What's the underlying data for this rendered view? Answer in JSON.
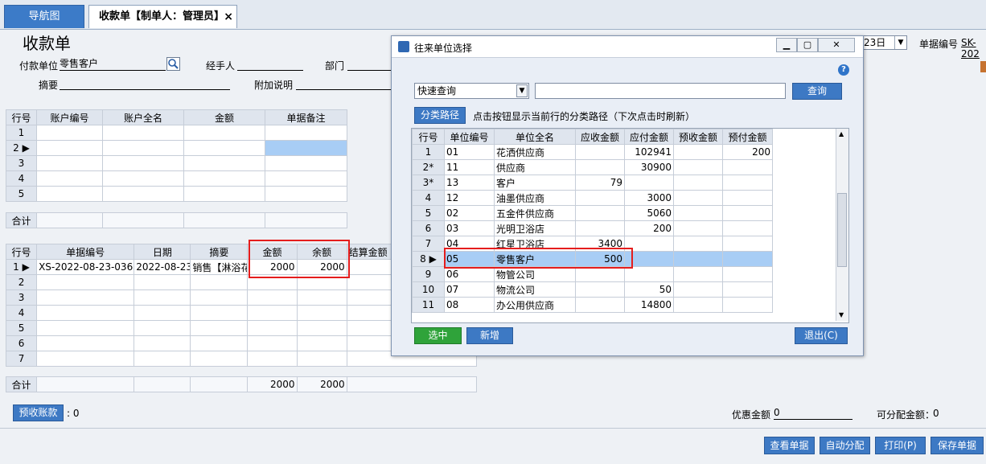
{
  "tabs": [
    {
      "label": "导航图"
    },
    {
      "label": "收款单【制单人：管理员】"
    }
  ],
  "tab_close": "×",
  "form": {
    "title": "收款单",
    "payer_label": "付款单位",
    "payer_value": "零售客户",
    "handler_label": "经手人",
    "dept_label": "部门",
    "summary_label": "摘要",
    "note_label": "附加说明",
    "date_value": "23日",
    "docno_label": "单据编号",
    "docno_value": "SK-202"
  },
  "account_grid": {
    "headers": [
      "行号",
      "账户编号",
      "账户全名",
      "金额",
      "单据备注"
    ],
    "rows": [
      "1",
      "2",
      "3",
      "4",
      "5"
    ],
    "total_label": "合计"
  },
  "doc_grid": {
    "headers": [
      "行号",
      "单据编号",
      "日期",
      "摘要",
      "金额",
      "余额",
      "结算金额"
    ],
    "rows": [
      {
        "n": "1",
        "docno": "XS-2022-08-23-036",
        "date": "2022-08-23",
        "summary": "销售【淋浴花",
        "amount": "2000",
        "balance": "2000"
      },
      {
        "n": "2"
      },
      {
        "n": "3"
      },
      {
        "n": "4"
      },
      {
        "n": "5"
      },
      {
        "n": "6"
      },
      {
        "n": "7"
      }
    ],
    "total_label": "合计",
    "total_amount": "2000",
    "total_balance": "2000"
  },
  "footer": {
    "prepay_button": "预收账款",
    "prepay_value": ": 0",
    "discount_label": "优惠金额",
    "discount_value": "0",
    "allocatable_label": "可分配金额：",
    "allocatable_value": "0",
    "buttons": [
      "查看单据",
      "自动分配",
      "打印(P)",
      "保存单据"
    ]
  },
  "dialog": {
    "title": "往来单位选择",
    "help": "?",
    "quick_query": "快速查询",
    "search_value": "",
    "query_button": "查询",
    "path_button": "分类路径",
    "path_hint": "点击按钮显示当前行的分类路径（下次点击时刷新）",
    "headers": [
      "行号",
      "单位编号",
      "单位全名",
      "应收金额",
      "应付金额",
      "预收金额",
      "预付金额"
    ],
    "rows": [
      {
        "n": "1",
        "code": "01",
        "name": "花洒供应商",
        "recv": "",
        "pay": "102941",
        "pre_recv": "",
        "pre_pay": "200"
      },
      {
        "n": "2*",
        "code": "11",
        "name": "供应商",
        "recv": "",
        "pay": "30900",
        "pre_recv": "",
        "pre_pay": ""
      },
      {
        "n": "3*",
        "code": "13",
        "name": "客户",
        "recv": "79",
        "pay": "",
        "pre_recv": "",
        "pre_pay": ""
      },
      {
        "n": "4",
        "code": "12",
        "name": "油墨供应商",
        "recv": "",
        "pay": "3000",
        "pre_recv": "",
        "pre_pay": ""
      },
      {
        "n": "5",
        "code": "02",
        "name": "五金件供应商",
        "recv": "",
        "pay": "5060",
        "pre_recv": "",
        "pre_pay": ""
      },
      {
        "n": "6",
        "code": "03",
        "name": "光明卫浴店",
        "recv": "",
        "pay": "200",
        "pre_recv": "",
        "pre_pay": ""
      },
      {
        "n": "7",
        "code": "04",
        "name": "红星卫浴店",
        "recv": "3400",
        "pay": "",
        "pre_recv": "",
        "pre_pay": ""
      },
      {
        "n": "8",
        "code": "05",
        "name": "零售客户",
        "recv": "500",
        "pay": "",
        "pre_recv": "",
        "pre_pay": ""
      },
      {
        "n": "9",
        "code": "06",
        "name": "物管公司",
        "recv": "",
        "pay": "",
        "pre_recv": "",
        "pre_pay": ""
      },
      {
        "n": "10",
        "code": "07",
        "name": "物流公司",
        "recv": "",
        "pay": "50",
        "pre_recv": "",
        "pre_pay": ""
      },
      {
        "n": "11",
        "code": "08",
        "name": "办公用供应商",
        "recv": "",
        "pay": "14800",
        "pre_recv": "",
        "pre_pay": ""
      }
    ],
    "select_button": "选中",
    "new_button": "新增",
    "exit_button": "退出(C)"
  },
  "colors": {
    "accent": "#3d79c4",
    "highlight": "#e51d1d",
    "selected_row": "#a8cdf5"
  }
}
